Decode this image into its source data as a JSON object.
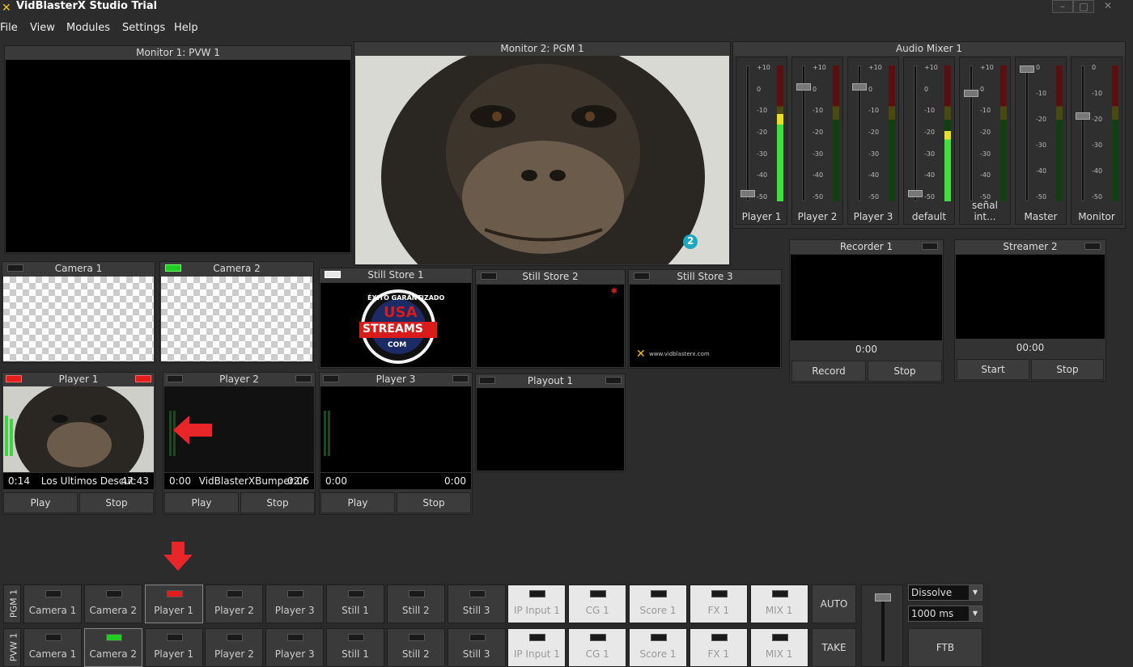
{
  "app": {
    "title": "VidBlasterX Studio Trial"
  },
  "menu": [
    "File",
    "View",
    "Modules",
    "Settings",
    "Help"
  ],
  "monitors": {
    "pvw": "Monitor 1: PVW 1",
    "pgm": "Monitor 2: PGM 1",
    "pgm_overlay": "2"
  },
  "audio": {
    "title": "Audio Mixer 1",
    "channels": [
      "Player 1",
      "Player 2",
      "Player 3",
      "default",
      "señal int...",
      "Master",
      "Monitor"
    ],
    "scale_a": [
      "+10",
      "0",
      "-10",
      "-20",
      "-30",
      "-40",
      "-50"
    ],
    "scale_b": [
      "0",
      "-10",
      "-20",
      "-30",
      "-40",
      "-50"
    ]
  },
  "cameras": [
    "Camera 1",
    "Camera 2"
  ],
  "stills": [
    "Still Store 1",
    "Still Store 2",
    "Still Store 3"
  ],
  "still1_logo": {
    "top": "ÉXITO GARANTIZADO",
    "mid": "USA",
    "main": "STREAMS",
    "bottom": "COM"
  },
  "still3_text": "www.vidblasterx.com",
  "players": [
    {
      "name": "Player 1",
      "time": "0:14",
      "file": "Los Ultimos Descut",
      "duration": "47:43",
      "play": "Play",
      "stop": "Stop"
    },
    {
      "name": "Player 2",
      "time": "0:00",
      "file": "VidBlasterXBumper2.r",
      "duration": "0:06",
      "play": "Play",
      "stop": "Stop"
    },
    {
      "name": "Player 3",
      "time": "0:00",
      "file": "",
      "duration": "0:00",
      "play": "Play",
      "stop": "Stop"
    }
  ],
  "playout": "Playout 1",
  "recorder": {
    "title": "Recorder 1",
    "time": "0:00",
    "record": "Record",
    "stop": "Stop"
  },
  "streamer": {
    "title": "Streamer 2",
    "time": "00:00",
    "start": "Start",
    "stop": "Stop"
  },
  "switcher": {
    "pgm_label": "PGM 1",
    "pvw_label": "PVW 1",
    "sources": [
      "Camera 1",
      "Camera 2",
      "Player 1",
      "Player 2",
      "Player 3",
      "Still 1",
      "Still 2",
      "Still 3",
      "IP Input 1",
      "CG 1",
      "Score 1",
      "FX 1",
      "MIX 1"
    ],
    "pgm_active": "Player 1",
    "pvw_active": "Camera 2",
    "auto": "AUTO",
    "take": "TAKE",
    "ftb": "FTB",
    "transition": "Dissolve",
    "duration": "1000 ms"
  },
  "colors": {
    "tally_red": "#e41c1c",
    "tally_green": "#22cc22",
    "accent_arrow": "#e8262a"
  }
}
